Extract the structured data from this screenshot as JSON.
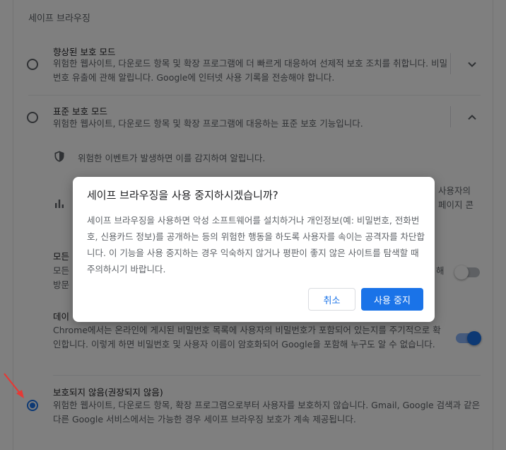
{
  "section": {
    "title": "세이프 브라우징"
  },
  "options": {
    "enhanced": {
      "title": "향상된 보호 모드",
      "desc": "위험한 웹사이트, 다운로드 항목 및 확장 프로그램에 더 빠르게 대응하여 선제적 보호 조치를 취합니다. 비밀번호 유출에 관해 알립니다. Google에 인터넷 사용 기록을 전송해야 합니다."
    },
    "standard": {
      "title": "표준 보호 모드",
      "desc": "위험한 웹사이트, 다운로드 항목 및 확장 프로그램에 대응하는 표준 보호 기능입니다.",
      "info_line": "위험한 이벤트가 발생하면 이를 감지하여 알립니다.",
      "partial_right_1": "사용자의",
      "partial_right_2": "페이지 콘"
    },
    "hidden_rows": {
      "row1_title_fragment": "모든",
      "row1_desc_fragment": "모든",
      "row1_desc_fragment2": "방문",
      "row1_right_fragment": "해",
      "row2_title_fragment": "데이",
      "row2_desc": "Chrome에서는 온라인에 게시된 비밀번호 목록에 사용자의 비밀번호가 포함되어 있는지를 주기적으로 확인합니다. 이렇게 하면 비밀번호 및 사용자 이름이 암호화되어 Google을 포함해 누구도 알 수 없습니다."
    },
    "none": {
      "title": "보호되지 않음(권장되지 않음)",
      "desc": "위험한 웹사이트, 다운로드 항목, 확장 프로그램으로부터 사용자를 보호하지 않습니다. Gmail, Google 검색과 같은 다른 Google 서비스에서는 가능한 경우 세이프 브라우징 보호가 계속 제공됩니다."
    }
  },
  "dialog": {
    "title": "세이프 브라우징을 사용 중지하시겠습니까?",
    "body": "세이프 브라우징을 사용하면 악성 소프트웨어를 설치하거나 개인정보(예: 비밀번호, 전화번호, 신용카드 정보)를 공개하는 등의 위험한 행동을 하도록 사용자를 속이는 공격자를 차단합니다. 이 기능을 사용 중지하는 경우 익숙하지 않거나 평판이 좋지 않은 사이트를 탐색할 때 주의하시기 바랍니다.",
    "cancel_label": "취소",
    "confirm_label": "사용 중지"
  },
  "icons": {
    "radio": "radio-button-icon",
    "expand": "chevron-down-icon",
    "collapse": "chevron-up-icon",
    "shield": "shield-icon",
    "chart": "bar-chart-icon",
    "annotation": "red-arrow-icon"
  },
  "colors": {
    "accent": "#1a73e8",
    "scrim": "rgba(0,0,0,0.5)",
    "annotation_arrow": "#e53935"
  }
}
